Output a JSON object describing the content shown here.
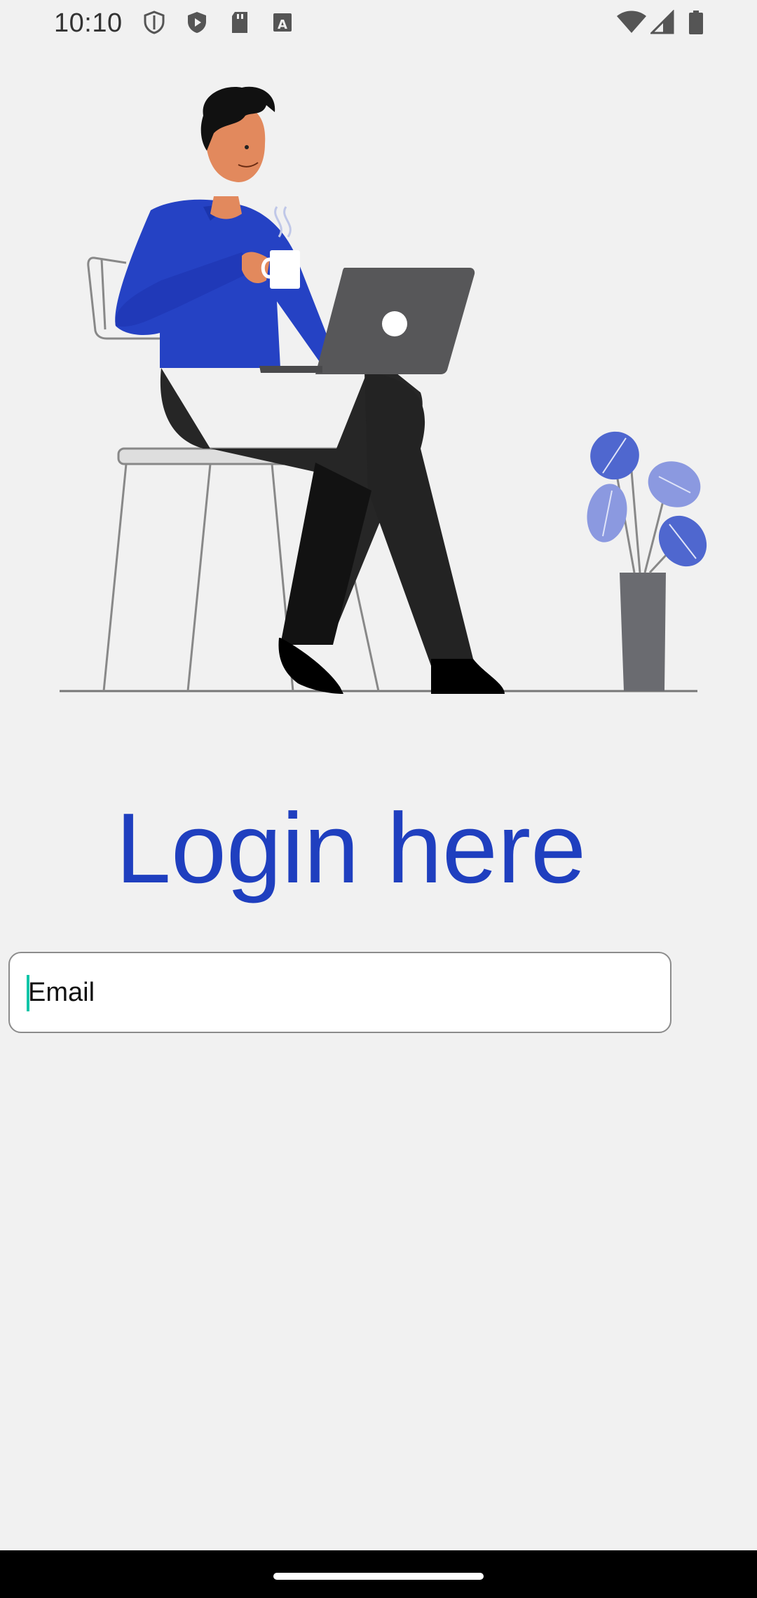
{
  "status_bar": {
    "time": "10:10",
    "left_icons": [
      "shield-outline-icon",
      "shield-play-icon",
      "sd-card-icon",
      "font-a-icon"
    ],
    "right_icons": [
      "wifi-icon",
      "cellular-signal-icon",
      "battery-icon"
    ]
  },
  "illustration": {
    "description_icon": "person-with-laptop-illustration"
  },
  "login": {
    "title": "Login here",
    "email_placeholder": "Email"
  },
  "colors": {
    "accent": "#1f3fbf",
    "background": "#f1f1f1",
    "caret": "#11c5a8"
  }
}
